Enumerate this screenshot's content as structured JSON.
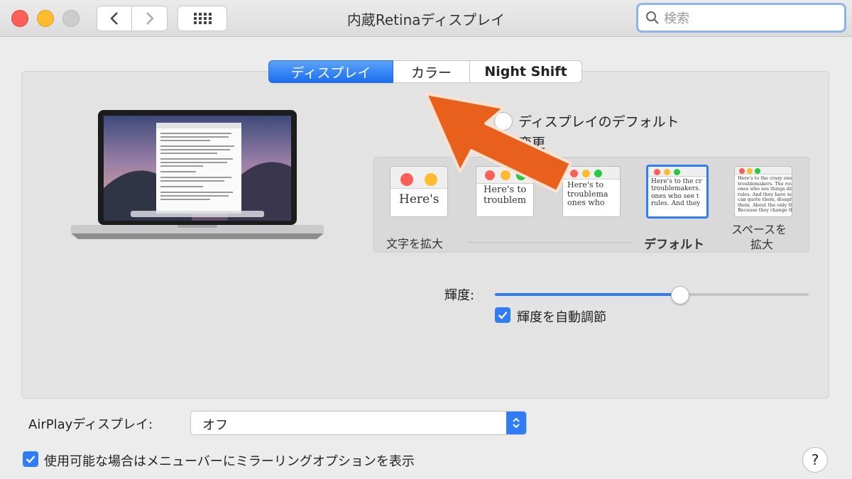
{
  "window": {
    "title": "内蔵Retinaディスプレイ"
  },
  "search": {
    "placeholder": "検索"
  },
  "tabs": [
    {
      "label": "ディスプレイ",
      "selected": true
    },
    {
      "label": "カラー",
      "selected": false
    },
    {
      "label": "Night Shift",
      "selected": false
    }
  ],
  "resolution": {
    "options": [
      {
        "label": "ディスプレイのデフォルト",
        "selected": false
      },
      {
        "label": "変更",
        "selected": true
      }
    ]
  },
  "scaled": {
    "thumbs": [
      {
        "text": "Here's"
      },
      {
        "text": "Here's to\ntroublem"
      },
      {
        "text": "Here's to\ntroublema\nones who"
      },
      {
        "text": "Here's to the cr\ntroublemakers.\nones who see t\nrules. And they"
      },
      {
        "text": "Here's to the crazy one\ntroublemakers. The rou\nones who see things dif\nrules. And they have no\ncan quote them, disagr\nthem. About the only th\nBecause they change th"
      }
    ],
    "label_larger": "文字を拡大",
    "label_default": "デフォルト",
    "label_more_space_1": "スペースを",
    "label_more_space_2": "拡大",
    "selected_index": 3
  },
  "brightness": {
    "label": "輝度:",
    "value": 0.59,
    "auto_label": "輝度を自動調節",
    "auto_checked": true
  },
  "airplay": {
    "label": "AirPlayディスプレイ:",
    "value": "オフ"
  },
  "mirroring": {
    "label": "使用可能な場合はメニューバーにミラーリングオプションを表示",
    "checked": true
  },
  "help": {
    "label": "?"
  },
  "colors": {
    "accent": "#2f7cf6",
    "arrow": "#e8601c"
  }
}
